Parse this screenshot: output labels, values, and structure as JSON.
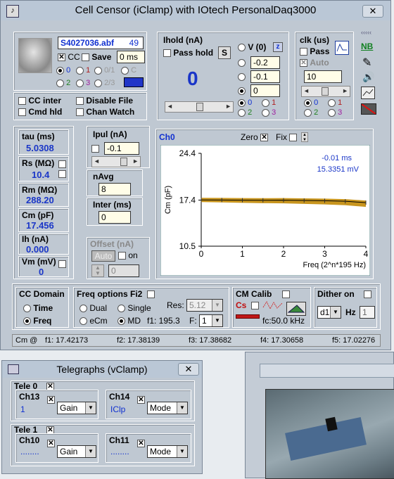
{
  "main_window": {
    "title": "Cell Censor (iClamp) with IOtech PersonalDaq3000",
    "close_label": "✕"
  },
  "file": {
    "name": "S4027036.abf",
    "index": "49",
    "cc_label": "CC",
    "save_label": "Save",
    "time": "0 ms",
    "radios": [
      "0",
      "1",
      "0/1",
      "C",
      "2",
      "3",
      "2/3"
    ]
  },
  "options": {
    "cc_inter": "CC inter",
    "cmd_hld": "Cmd hld",
    "disable_file": "Disable File",
    "chan_watch": "Chan Watch"
  },
  "ihold": {
    "title": "Ihold (nA)",
    "pass_hold": "Pass hold",
    "s_btn": "S",
    "value": "0",
    "v0_label": "V (0)",
    "z_btn": "z",
    "v1": "-0.2",
    "v2": "-0.1",
    "v3": "0",
    "chans": [
      "0",
      "1",
      "2",
      "3"
    ]
  },
  "clk": {
    "title": "clk (us)",
    "pass": "Pass",
    "auto": "Auto",
    "value": "10",
    "chans": [
      "0",
      "1",
      "2",
      "3"
    ]
  },
  "side": {
    "nb": "NB"
  },
  "params": {
    "tau_label": "tau (ms)",
    "tau": "5.0308",
    "rs_label": "Rs (MΩ)",
    "rs": "10.4",
    "rm_label": "Rm (MΩ)",
    "rm": "288.20",
    "cm_label": "Cm (pF)",
    "cm": "17.456",
    "ih_label": "Ih (nA)",
    "ih": "0.000",
    "vm_label": "Vm (mV)",
    "vm": "0"
  },
  "ipul": {
    "title": "Ipul (nA)",
    "value": "-0.1"
  },
  "navg": {
    "title": "nAvg",
    "value": "8"
  },
  "inter": {
    "title": "Inter (ms)",
    "value": "0"
  },
  "offset": {
    "title": "Offset (nA)",
    "auto": "Auto",
    "on": "on",
    "value": "0"
  },
  "chart_panel": {
    "channel": "Ch0",
    "zero": "Zero",
    "fix": "Fix",
    "readout_ms": "-0.01 ms",
    "readout_mv": "15.3351 mV"
  },
  "chart_data": {
    "type": "line",
    "ylabel": "Cm (pF)",
    "xlabel": "Freq (2^n*195 Hz)",
    "ylim": [
      10.5,
      24.4
    ],
    "xlim": [
      0,
      4
    ],
    "yticks": [
      "24.4",
      "17.4",
      "10.5"
    ],
    "xticks": [
      "0",
      "1",
      "2",
      "3",
      "4"
    ],
    "series": [
      {
        "name": "",
        "x": [
          0,
          0.5,
          1,
          1.5,
          2,
          2.5,
          3,
          3.5,
          4
        ],
        "values": [
          17.42,
          17.41,
          17.38,
          17.37,
          17.39,
          17.34,
          17.31,
          17.22,
          17.02
        ]
      }
    ],
    "colors": {
      "line": "#000000",
      "band": "#c8951e",
      "background": "#ffffff"
    }
  },
  "domain": {
    "title": "CC Domain",
    "time": "Time",
    "freq": "Freq"
  },
  "freq_opts": {
    "title": "Freq options Fi2",
    "dual": "Dual",
    "single": "Single",
    "ecm": "eCm",
    "md": "MD",
    "res_label": "Res:",
    "res": "5.12",
    "f1_label": "f1: 195.3",
    "f_label": "F:",
    "f_val": "1"
  },
  "cmcalib": {
    "title": "CM Calib",
    "cs": "Cs",
    "fc": "fc:50.0 kHz"
  },
  "dither": {
    "title": "Dither on",
    "d1": "d1",
    "hz": "Hz",
    "hz_val": "1"
  },
  "status": {
    "label": "Cm @",
    "f1": "f1: 17.42173",
    "f2": "f2: 17.38139",
    "f3": "f3: 17.38682",
    "f4": "f4: 17.30658",
    "f5": "f5: 17.02276"
  },
  "telegraphs": {
    "title": "Telegraphs (vClamp)",
    "close": "✕",
    "tele0": "Tele 0",
    "tele1": "Tele 1",
    "ch13": "Ch13",
    "ch13_val": "1",
    "ch14": "Ch14",
    "ch14_val": "IClp",
    "ch10": "Ch10",
    "ch10_val": "........",
    "ch11": "Ch11",
    "ch11_val": "........",
    "gain": "Gain",
    "mode": "Mode"
  }
}
